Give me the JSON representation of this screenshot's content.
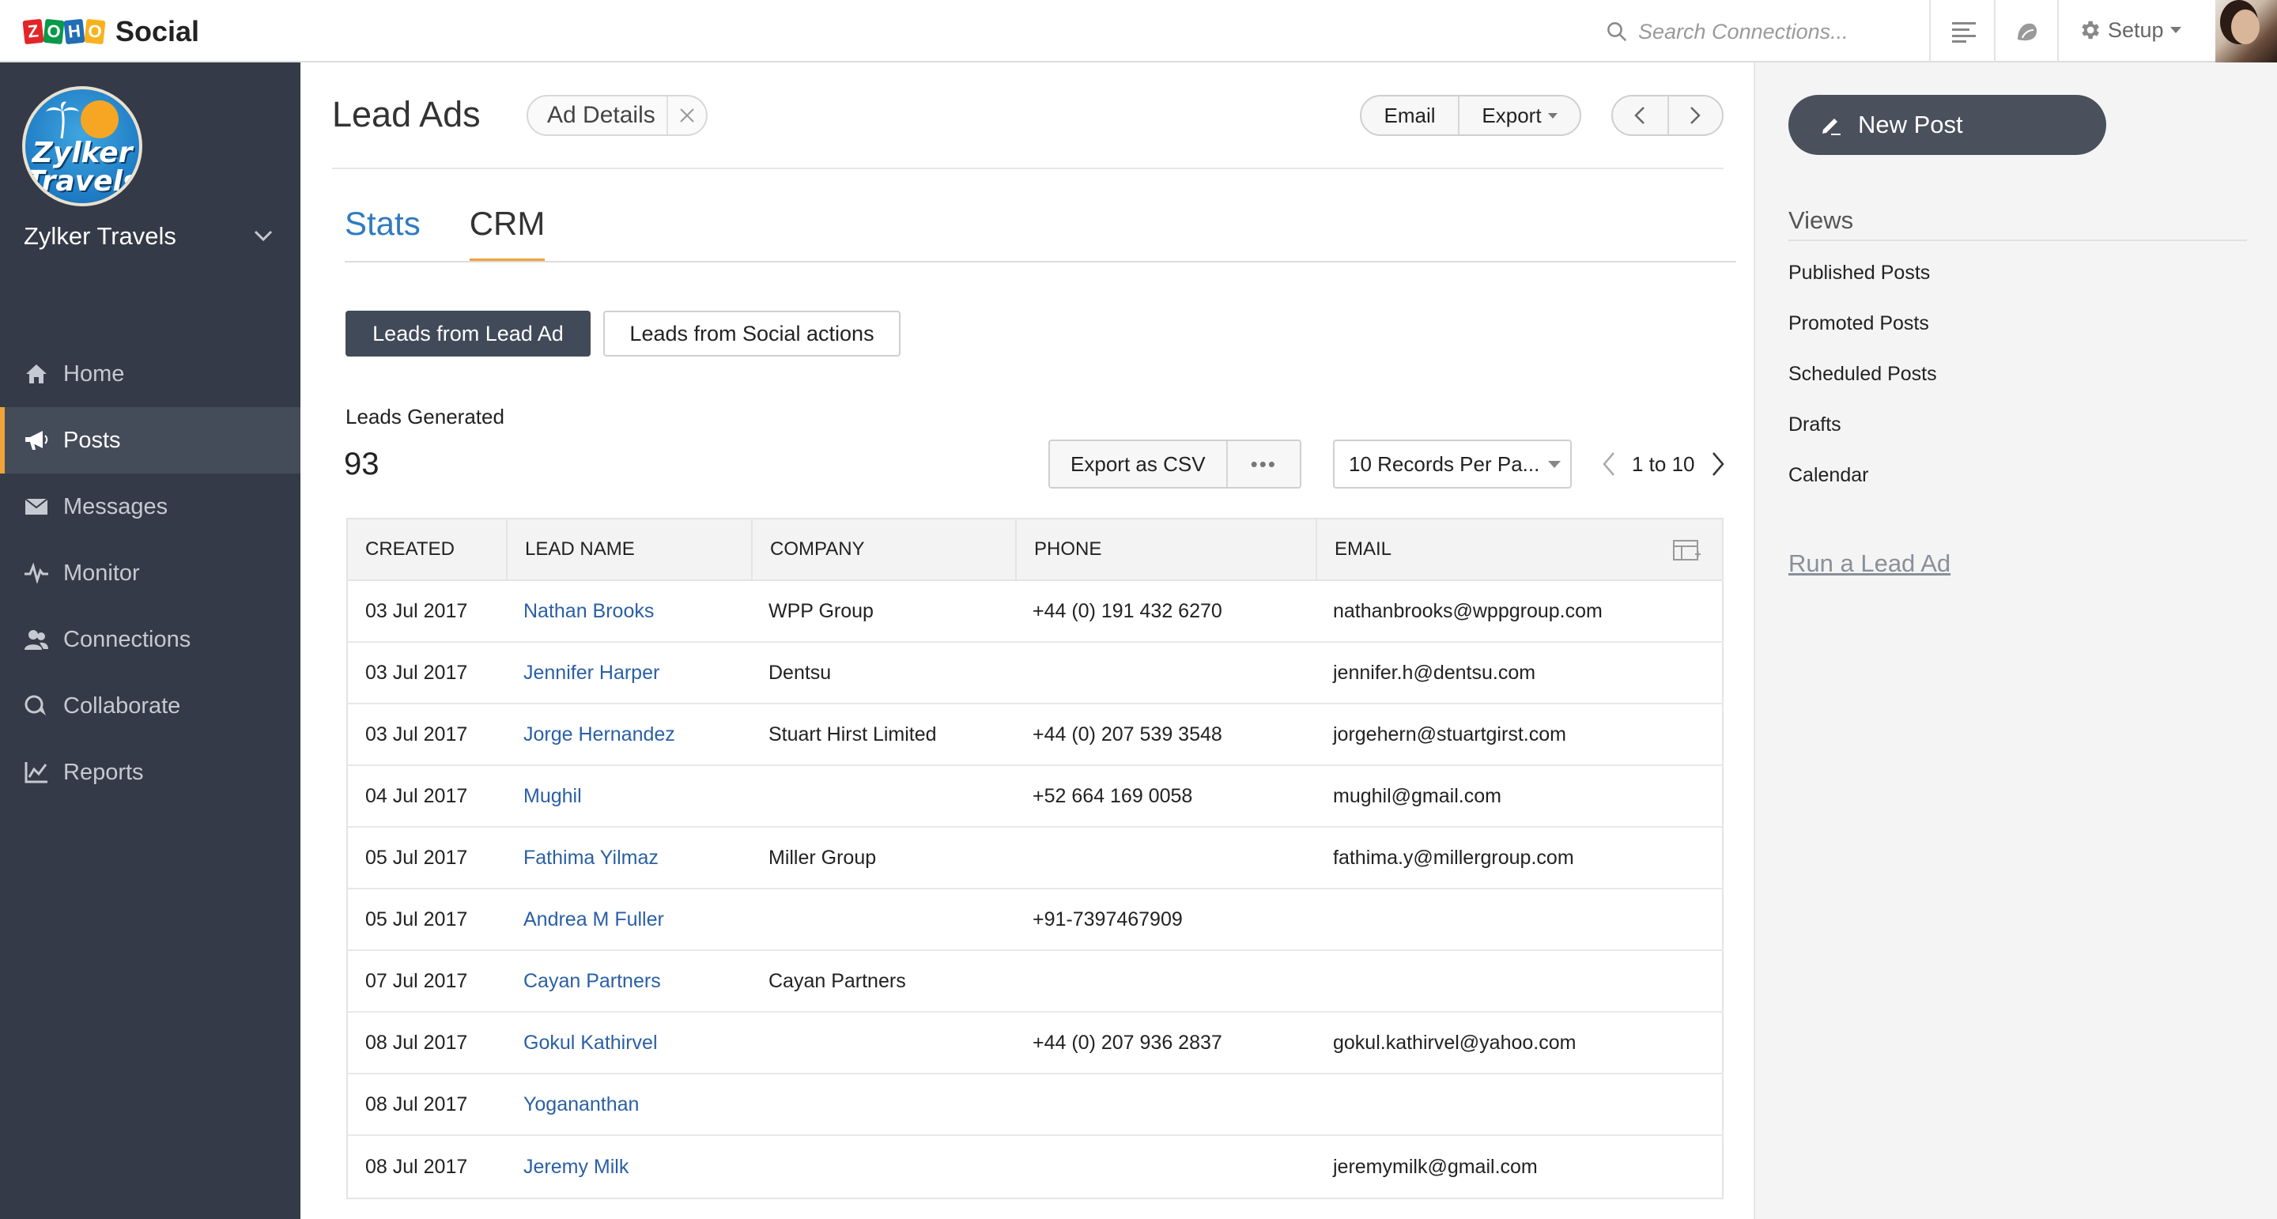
{
  "app": {
    "brand_letters": [
      "Z",
      "O",
      "H",
      "O"
    ],
    "name": "Social"
  },
  "topbar": {
    "search_placeholder": "Search Connections...",
    "setup_label": "Setup"
  },
  "sidebar": {
    "brand_logo": {
      "line1": "Zylker",
      "line2": "Travels"
    },
    "brand_name": "Zylker Travels",
    "items": [
      {
        "label": "Home",
        "icon": "home-icon"
      },
      {
        "label": "Posts",
        "icon": "megaphone-icon",
        "active": true
      },
      {
        "label": "Messages",
        "icon": "envelope-icon"
      },
      {
        "label": "Monitor",
        "icon": "pulse-icon"
      },
      {
        "label": "Connections",
        "icon": "users-icon"
      },
      {
        "label": "Collaborate",
        "icon": "chat-icon"
      },
      {
        "label": "Reports",
        "icon": "line-chart-icon"
      }
    ],
    "accent_color": "#f0a23b"
  },
  "main": {
    "title": "Lead Ads",
    "chip_label": "Ad Details",
    "email_button": "Email",
    "export_button": "Export",
    "tabs": [
      {
        "label": "Stats"
      },
      {
        "label": "CRM",
        "active": true
      }
    ],
    "segments": {
      "lead_ad": "Leads from Lead Ad",
      "social": "Leads from Social actions"
    },
    "leads_label": "Leads Generated",
    "leads_count": "93",
    "export_csv": "Export as CSV",
    "more_label": "•••",
    "records_per_page": "10 Records Per Pa...",
    "pager_range": "1 to 10",
    "table": {
      "headers": [
        "CREATED",
        "LEAD NAME",
        "COMPANY",
        "PHONE",
        "EMAIL"
      ],
      "rows": [
        [
          "03 Jul 2017",
          "Nathan Brooks",
          "WPP Group",
          "+44 (0) 191 432 6270",
          "nathanbrooks@wppgroup.com"
        ],
        [
          "03 Jul 2017",
          "Jennifer Harper",
          "Dentsu",
          "",
          "jennifer.h@dentsu.com"
        ],
        [
          "03 Jul 2017",
          "Jorge Hernandez",
          "Stuart Hirst Limited",
          "+44 (0) 207 539 3548",
          "jorgehern@stuartgirst.com"
        ],
        [
          "04 Jul 2017",
          "Mughil",
          "",
          "+52 664 169 0058",
          "mughil@gmail.com"
        ],
        [
          "05 Jul 2017",
          "Fathima Yilmaz",
          "Miller Group",
          "",
          "fathima.y@millergroup.com"
        ],
        [
          "05 Jul 2017",
          "Andrea M Fuller",
          "",
          "+91-7397467909",
          ""
        ],
        [
          "07 Jul 2017",
          "Cayan Partners",
          "Cayan Partners",
          "",
          ""
        ],
        [
          "08 Jul 2017",
          "Gokul Kathirvel",
          "",
          "+44 (0) 207 936 2837",
          "gokul.kathirvel@yahoo.com"
        ],
        [
          "08 Jul 2017",
          "Yogananthan",
          "",
          "",
          ""
        ],
        [
          "08 Jul 2017",
          "Jeremy Milk",
          "",
          "",
          "jeremymilk@gmail.com"
        ]
      ]
    }
  },
  "right_panel": {
    "new_post": "New Post",
    "views_title": "Views",
    "views": [
      "Published Posts",
      "Promoted Posts",
      "Scheduled Posts",
      "Drafts",
      "Calendar"
    ],
    "run_lead_ad": "Run a Lead Ad"
  }
}
